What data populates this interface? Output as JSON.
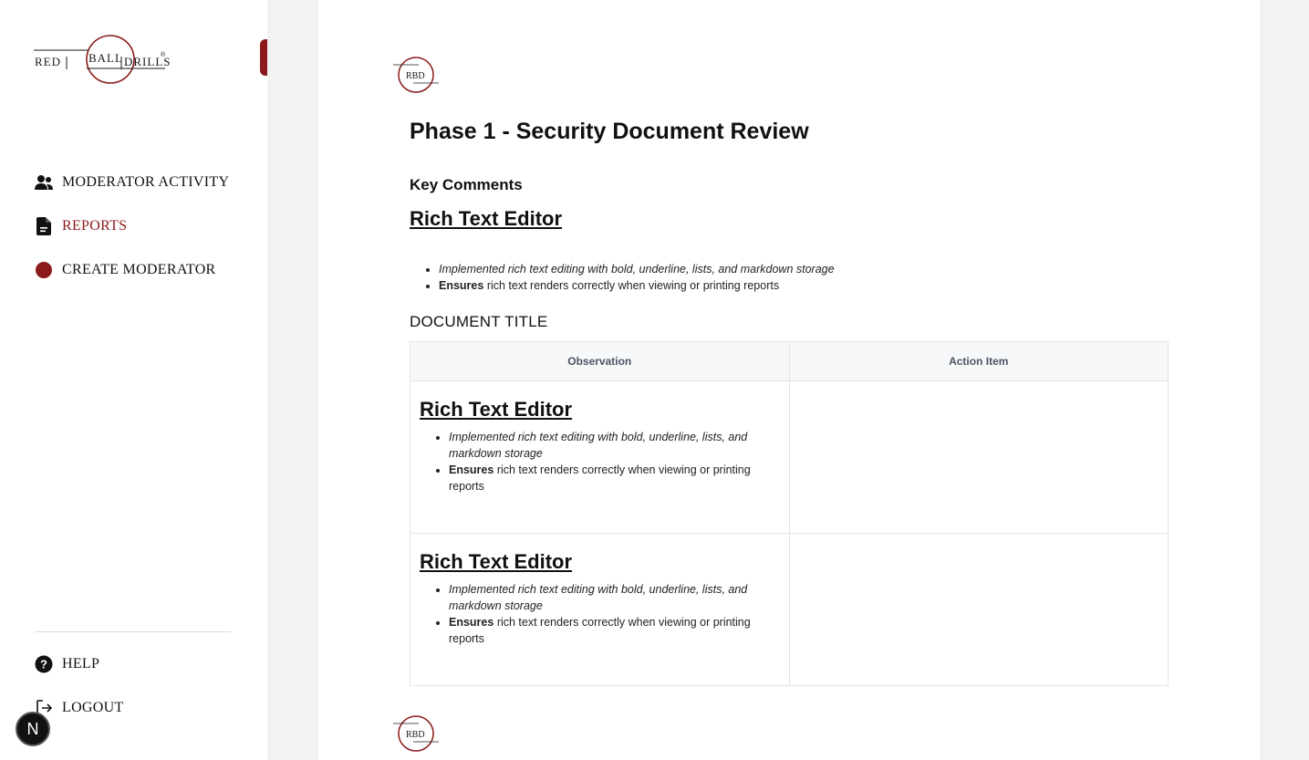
{
  "brand": {
    "name_parts": [
      "RED",
      "BALL",
      "DRILLS"
    ],
    "mark": "®",
    "accent_color": "#8b1a1a"
  },
  "sidebar": {
    "items": [
      {
        "label": "MODERATOR ACTIVITY",
        "icon": "users-icon",
        "active": false
      },
      {
        "label": "REPORTS",
        "icon": "document-icon",
        "active": true
      },
      {
        "label": "CREATE MODERATOR",
        "icon": "red-dot-icon",
        "active": false
      }
    ],
    "bottom_items": [
      {
        "label": "HELP",
        "icon": "help-icon"
      },
      {
        "label": "LOGOUT",
        "icon": "logout-icon"
      }
    ],
    "fab_label": "N"
  },
  "document": {
    "logo_text": "RBD",
    "title": "Phase 1 - Security Document Review",
    "key_comments_heading": "Key Comments",
    "rich_text": {
      "heading": "Rich Text Editor",
      "bullet1": "Implemented rich text editing with bold, underline, lists, and markdown storage",
      "bullet2_bold": "Ensures",
      "bullet2_rest": " rich text renders correctly when viewing or printing reports"
    },
    "section_title": "DOCUMENT TITLE",
    "table": {
      "headers": [
        "Observation",
        "Action Item"
      ],
      "rows": [
        {
          "observation": {
            "heading": "Rich Text Editor",
            "bullet1": "Implemented rich text editing with bold, underline, lists, and markdown storage",
            "bullet2_bold": "Ensures",
            "bullet2_rest": " rich text renders correctly when viewing or printing reports"
          },
          "action_item": ""
        },
        {
          "observation": {
            "heading": "Rich Text Editor",
            "bullet1": "Implemented rich text editing with bold, underline, lists, and markdown storage",
            "bullet2_bold": "Ensures",
            "bullet2_rest": " rich text renders correctly when viewing or printing reports"
          },
          "action_item": ""
        }
      ]
    }
  }
}
